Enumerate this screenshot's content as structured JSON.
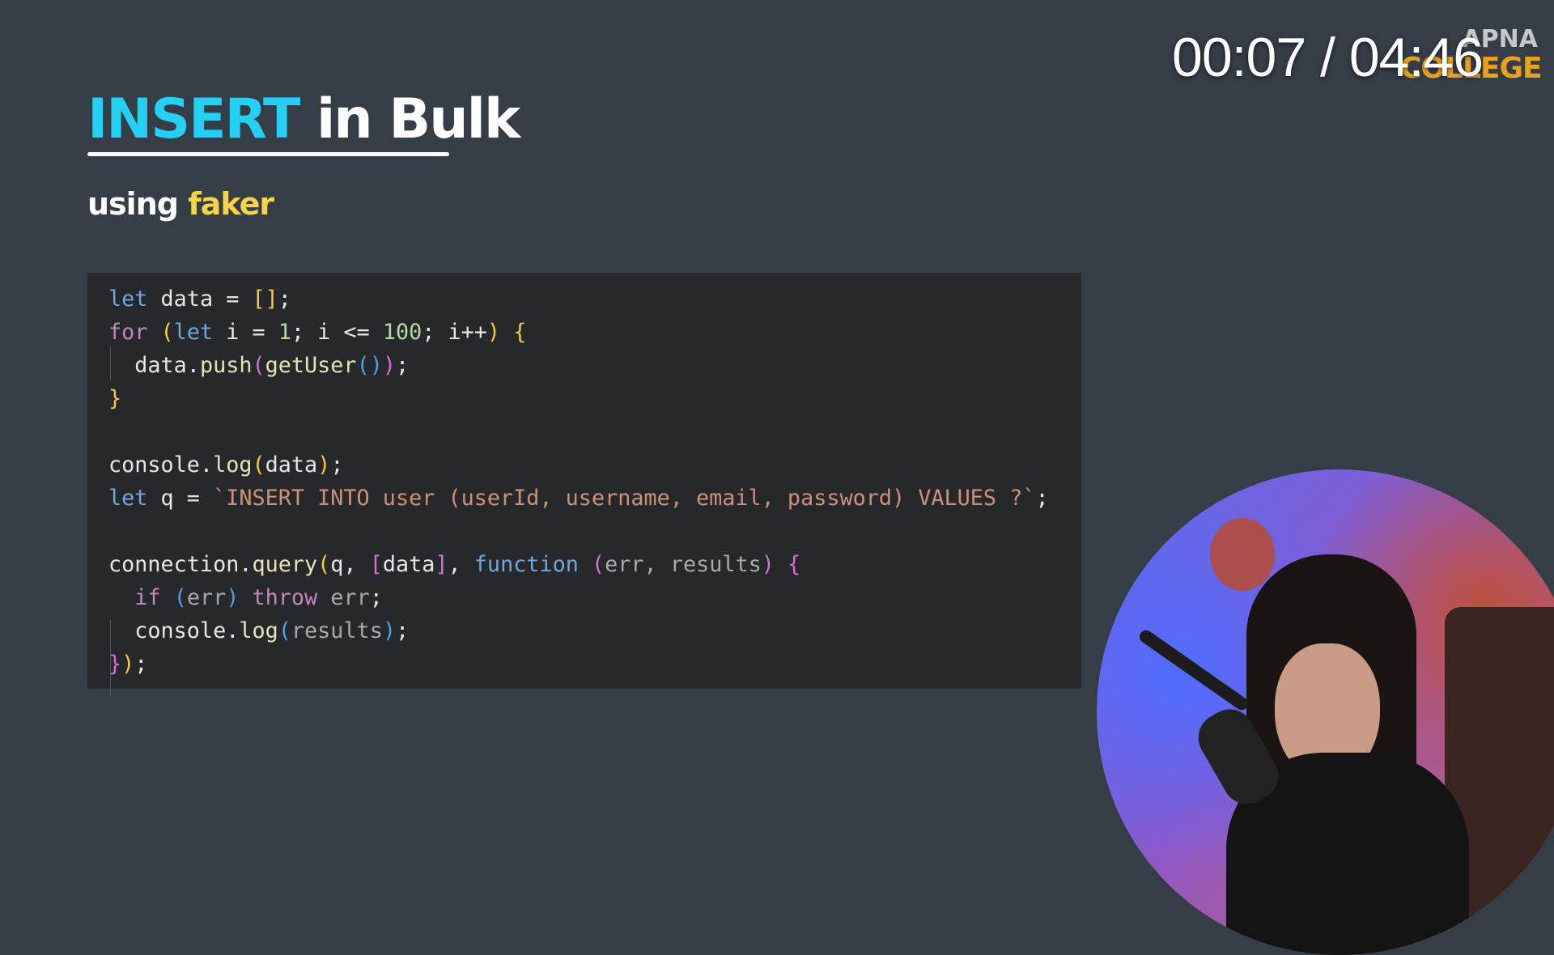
{
  "video": {
    "timestamp": "00:07 / 04:46",
    "logo_top": "APNA",
    "logo_bottom": "COLLEGE"
  },
  "slide": {
    "title_keyword": "INSERT",
    "title_rest": " in Bulk",
    "subtitle_prefix": "using ",
    "subtitle_highlight": "faker"
  },
  "code": {
    "lines": [
      [
        {
          "t": "let",
          "c": "kw"
        },
        {
          "t": " data = ",
          "c": "txt"
        },
        {
          "t": "[]",
          "c": "y"
        },
        {
          "t": ";",
          "c": "txt"
        }
      ],
      [
        {
          "t": "for",
          "c": "ctl"
        },
        {
          "t": " ",
          "c": "txt"
        },
        {
          "t": "(",
          "c": "y"
        },
        {
          "t": "let",
          "c": "kw"
        },
        {
          "t": " i = ",
          "c": "txt"
        },
        {
          "t": "1",
          "c": "num"
        },
        {
          "t": "; i <= ",
          "c": "txt"
        },
        {
          "t": "100",
          "c": "num"
        },
        {
          "t": "; i++",
          "c": "txt"
        },
        {
          "t": ")",
          "c": "y"
        },
        {
          "t": " ",
          "c": "txt"
        },
        {
          "t": "{",
          "c": "y"
        }
      ],
      [
        {
          "t": "  data.",
          "c": "txt"
        },
        {
          "t": "push",
          "c": "fn"
        },
        {
          "t": "(",
          "c": "p"
        },
        {
          "t": "getUser",
          "c": "fn"
        },
        {
          "t": "()",
          "c": "b"
        },
        {
          "t": ")",
          "c": "p"
        },
        {
          "t": ";",
          "c": "txt"
        }
      ],
      [
        {
          "t": "}",
          "c": "y"
        }
      ],
      [],
      [
        {
          "t": "console.",
          "c": "txt"
        },
        {
          "t": "log",
          "c": "fn"
        },
        {
          "t": "(",
          "c": "y"
        },
        {
          "t": "data",
          "c": "txt"
        },
        {
          "t": ")",
          "c": "y"
        },
        {
          "t": ";",
          "c": "txt"
        }
      ],
      [
        {
          "t": "let",
          "c": "kw"
        },
        {
          "t": " q = ",
          "c": "txt"
        },
        {
          "t": "`INSERT INTO user (userId, username, email, password) VALUES ?`",
          "c": "str"
        },
        {
          "t": ";",
          "c": "txt"
        }
      ],
      [],
      [
        {
          "t": "connection.",
          "c": "txt"
        },
        {
          "t": "query",
          "c": "fn"
        },
        {
          "t": "(",
          "c": "y"
        },
        {
          "t": "q, ",
          "c": "txt"
        },
        {
          "t": "[",
          "c": "p"
        },
        {
          "t": "data",
          "c": "txt"
        },
        {
          "t": "]",
          "c": "p"
        },
        {
          "t": ", ",
          "c": "txt"
        },
        {
          "t": "function",
          "c": "kw"
        },
        {
          "t": " ",
          "c": "txt"
        },
        {
          "t": "(",
          "c": "p"
        },
        {
          "t": "err, results",
          "c": "par"
        },
        {
          "t": ")",
          "c": "p"
        },
        {
          "t": " ",
          "c": "txt"
        },
        {
          "t": "{",
          "c": "p"
        }
      ],
      [
        {
          "t": "  ",
          "c": "txt"
        },
        {
          "t": "if",
          "c": "ctl"
        },
        {
          "t": " ",
          "c": "txt"
        },
        {
          "t": "(",
          "c": "b"
        },
        {
          "t": "err",
          "c": "par"
        },
        {
          "t": ")",
          "c": "b"
        },
        {
          "t": " ",
          "c": "txt"
        },
        {
          "t": "throw",
          "c": "ctl"
        },
        {
          "t": " ",
          "c": "txt"
        },
        {
          "t": "err",
          "c": "par"
        },
        {
          "t": ";",
          "c": "txt"
        }
      ],
      [
        {
          "t": "  console.",
          "c": "txt"
        },
        {
          "t": "log",
          "c": "fn"
        },
        {
          "t": "(",
          "c": "b"
        },
        {
          "t": "results",
          "c": "par"
        },
        {
          "t": ")",
          "c": "b"
        },
        {
          "t": ";",
          "c": "txt"
        }
      ],
      [
        {
          "t": "}",
          "c": "p"
        },
        {
          "t": ")",
          "c": "y"
        },
        {
          "t": ";",
          "c": "txt"
        }
      ]
    ]
  }
}
